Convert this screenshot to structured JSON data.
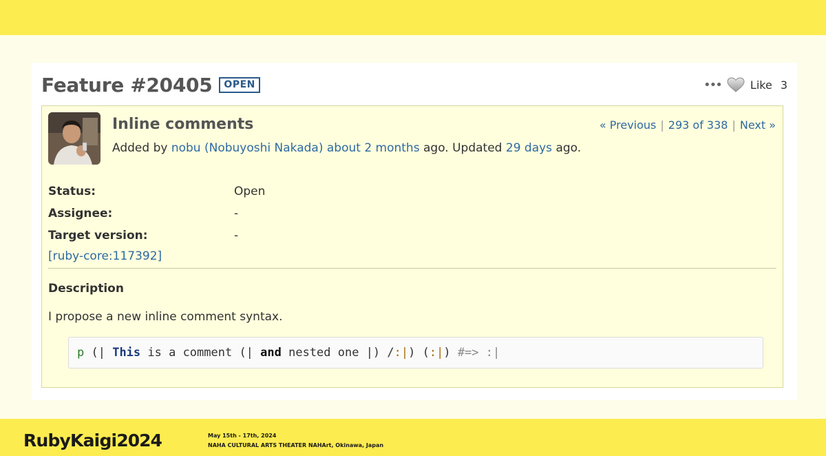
{
  "issue": {
    "title": "Feature #20405",
    "status_badge": "OPEN",
    "like_label": "Like",
    "like_count": "3",
    "subject": "Inline comments",
    "nav": {
      "previous": "« Previous",
      "position": "293 of 338",
      "next": "Next »",
      "sep": "|"
    },
    "added_by": {
      "prefix": "Added by",
      "author": "nobu (Nobuyoshi Nakada)",
      "created": "about 2 months",
      "middle": "ago. Updated",
      "updated": "29 days",
      "suffix": "ago."
    },
    "attributes": [
      {
        "label": "Status:",
        "value": "Open"
      },
      {
        "label": "Assignee:",
        "value": "-"
      },
      {
        "label": "Target version:",
        "value": "-"
      }
    ],
    "ruby_core_link": "[ruby-core:117392]",
    "description": {
      "heading": "Description",
      "text": "I propose a new inline comment syntax.",
      "code_tokens": {
        "t1": "p",
        "t2": " (| ",
        "t3": "This",
        "t4": " is a comment (| ",
        "t5": "and",
        "t6": " nested one |) /",
        "t7": ":|",
        "t8": ") (",
        "t9": ":|",
        "t10": ") ",
        "t11": "#=> :|"
      }
    }
  },
  "footer": {
    "brand": "RubyKaigi",
    "year": "2024",
    "date": "May 15th - 17th, 2024",
    "venue": "NAHA CULTURAL ARTS THEATER NAHArt, Okinawa, Japan"
  },
  "colors": {
    "accent_yellow": "#fdec50",
    "link": "#2e6aa3",
    "issue_bg": "#ffffdd"
  }
}
